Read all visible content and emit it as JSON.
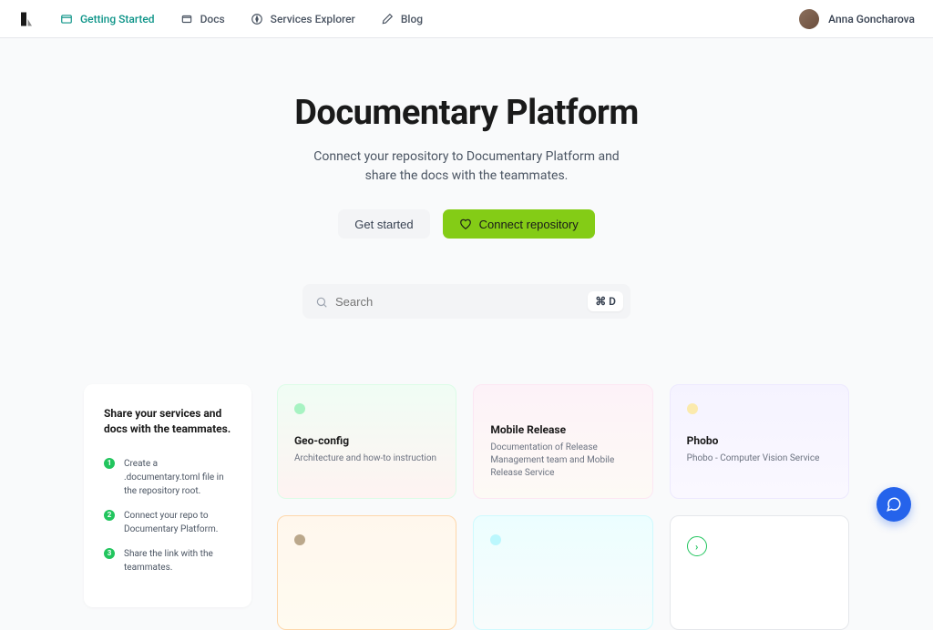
{
  "nav": {
    "items": [
      {
        "label": "Getting Started"
      },
      {
        "label": "Docs"
      },
      {
        "label": "Services Explorer"
      },
      {
        "label": "Blog"
      }
    ]
  },
  "user": {
    "name": "Anna Goncharova"
  },
  "hero": {
    "title": "Documentary Platform",
    "subtitle": "Connect your repository to Documentary Platform and share the docs with the teammates.",
    "get_started": "Get started",
    "connect_repo": "Connect repository"
  },
  "search": {
    "placeholder": "Search",
    "shortcut": "⌘ D"
  },
  "share": {
    "title": "Share your services and docs with the teammates.",
    "steps": [
      "Create a .documentary.toml file in the repository root.",
      "Connect your repo to Documentary Platform.",
      "Share the link with the teammates."
    ]
  },
  "cards": [
    {
      "name": "Geo-config",
      "desc": "Architecture and how-to instruction"
    },
    {
      "name": "Mobile Release",
      "desc": "Documentation of Release Management team and Mobile Release Service"
    },
    {
      "name": "Phobo",
      "desc": "Phobo - Computer Vision Service"
    }
  ]
}
